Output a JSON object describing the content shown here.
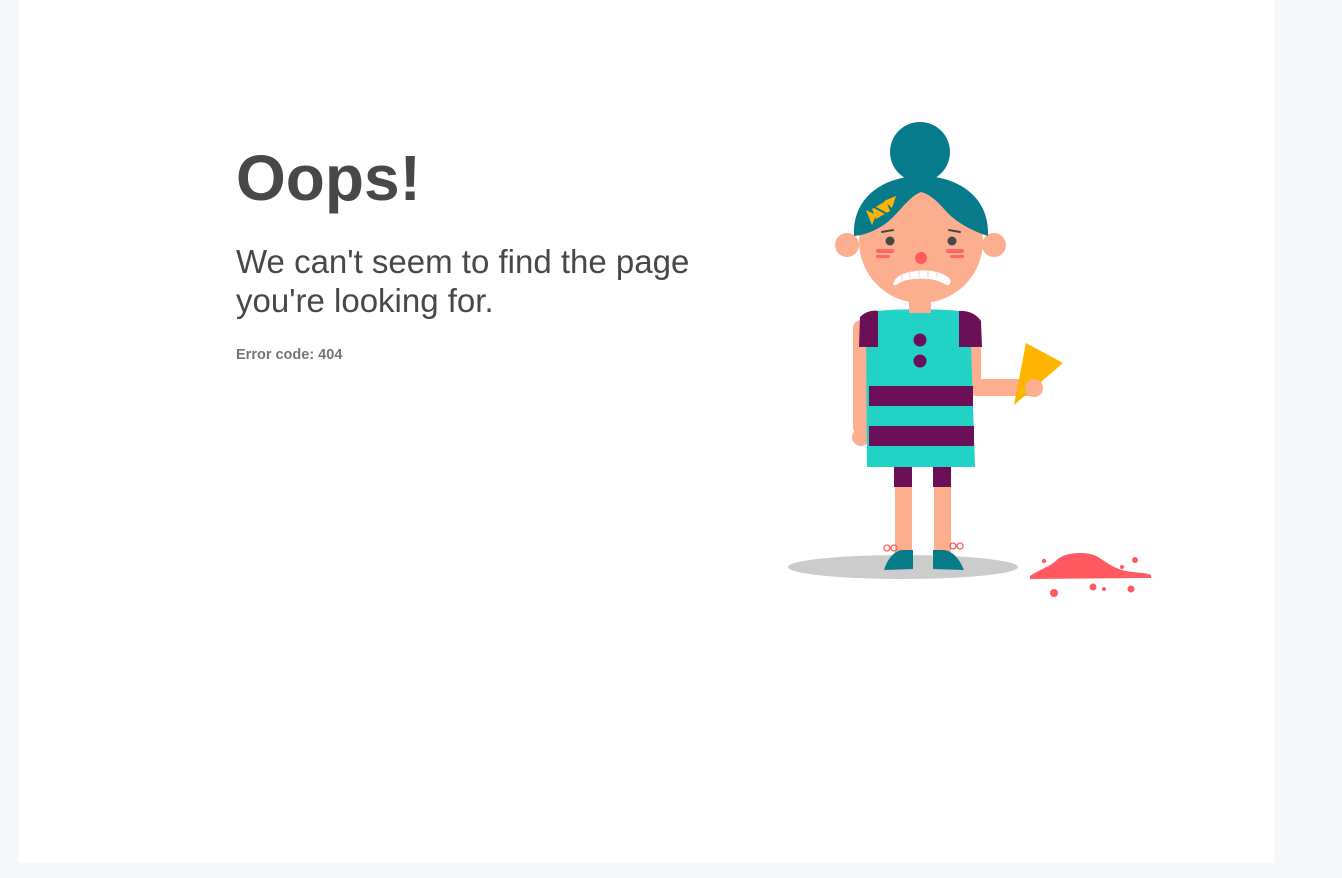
{
  "error_page": {
    "heading": "Oops!",
    "message": "We can't seem to find the page you're looking for.",
    "error_code_label": "Error code: 404"
  },
  "colors": {
    "page_background": "#f6f7fb",
    "card_background": "#ffffff",
    "heading_text": "#484848",
    "secondary_text": "#767676",
    "hair_teal": "#077b8a",
    "skin": "#fdae8f",
    "dress_cyan": "#22d3c5",
    "dress_stripe_purple": "#6b0f57",
    "ice_cream_cone_yellow": "#ffb400",
    "ice_cream_splat_red": "#ff5a5f",
    "shadow_gray": "#cccccc"
  },
  "illustration": {
    "icon": "crying-girl-dropped-ice-cream-illustration"
  }
}
